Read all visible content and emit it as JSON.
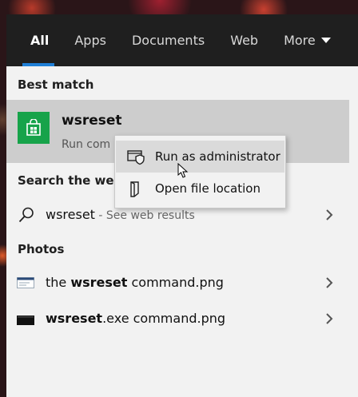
{
  "tabs": [
    {
      "label": "All",
      "active": true
    },
    {
      "label": "Apps"
    },
    {
      "label": "Documents"
    },
    {
      "label": "Web"
    },
    {
      "label": "More"
    }
  ],
  "best_match": {
    "heading": "Best match",
    "app_name": "wsreset",
    "app_subtitle": "Run com",
    "icon": "store-icon",
    "tile_color": "#17a34a"
  },
  "context_menu": {
    "items": [
      {
        "label": "Run as administrator",
        "icon": "shield-admin-icon"
      },
      {
        "label": "Open file location",
        "icon": "folder-location-icon"
      }
    ]
  },
  "web": {
    "heading": "Search the web",
    "query": "wsreset",
    "hint": " - See web results"
  },
  "photos": {
    "heading": "Photos",
    "items": [
      {
        "prefix": "the ",
        "bold": "wsreset",
        "suffix": " command.png"
      },
      {
        "prefix": "",
        "bold": "wsreset",
        "suffix": ".exe command.png"
      }
    ]
  },
  "colors": {
    "accent": "#1f7fd6",
    "tab_bar": "#1f1f1f",
    "panel": "#f2f2f2"
  }
}
